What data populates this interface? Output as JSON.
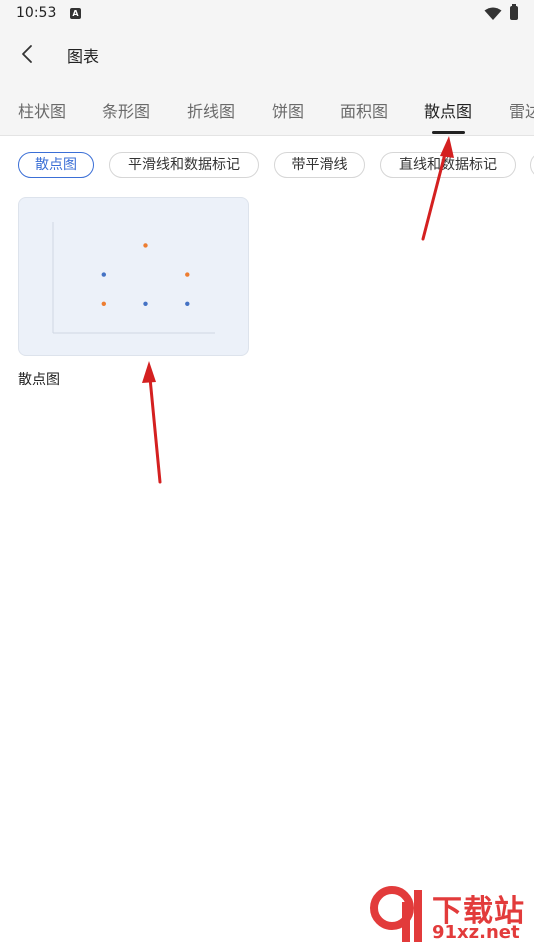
{
  "status_bar": {
    "time": "10:53",
    "app_badge": "A"
  },
  "header": {
    "title": "图表"
  },
  "tabs": [
    {
      "label": "柱状图",
      "active": false
    },
    {
      "label": "条形图",
      "active": false
    },
    {
      "label": "折线图",
      "active": false
    },
    {
      "label": "饼图",
      "active": false
    },
    {
      "label": "面积图",
      "active": false
    },
    {
      "label": "散点图",
      "active": true
    },
    {
      "label": "雷达",
      "active": false
    }
  ],
  "chips": [
    {
      "label": "散点图",
      "active": true
    },
    {
      "label": "平滑线和数据标记",
      "active": false
    },
    {
      "label": "带平滑线",
      "active": false
    },
    {
      "label": "直线和数据标记",
      "active": false
    }
  ],
  "card": {
    "label": "散点图"
  },
  "chart_data": {
    "type": "scatter",
    "series": [
      {
        "color": "#4472c4",
        "points": [
          [
            1,
            2
          ],
          [
            2,
            1
          ],
          [
            3,
            1
          ]
        ]
      },
      {
        "color": "#ed7d31",
        "points": [
          [
            1,
            1
          ],
          [
            2,
            3
          ],
          [
            3,
            2
          ]
        ]
      }
    ],
    "xlim": [
      0,
      4
    ],
    "ylim": [
      0,
      3.8
    ],
    "grid": false
  },
  "watermark": {
    "brand": "下载站",
    "url": "91xz.net"
  },
  "colors": {
    "accent": "#3b6fd6",
    "arrow": "#d42020",
    "watermark": "#e23b3b"
  }
}
